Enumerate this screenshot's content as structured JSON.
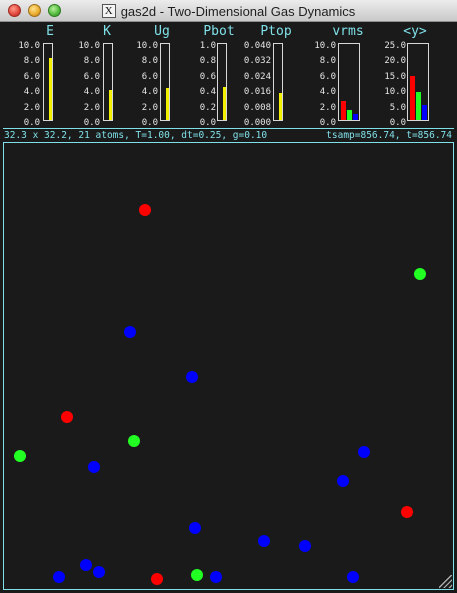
{
  "window": {
    "title": "gas2d - Two-Dimensional Gas Dynamics",
    "x_icon": "X"
  },
  "colors": {
    "label": "#7fe0e8",
    "bar_yellow": "#f0f000",
    "red": "#ff0000",
    "green": "#22ff22",
    "blue": "#0000ff",
    "background": "#1a1a1a"
  },
  "meters": [
    {
      "name": "E",
      "ticks": [
        "10.0",
        "8.0",
        "6.0",
        "4.0",
        "2.0",
        "0.0"
      ],
      "max": 10.0,
      "bars": [
        {
          "value": 8.1,
          "color": "#f0f000"
        }
      ]
    },
    {
      "name": "K",
      "ticks": [
        "10.0",
        "8.0",
        "6.0",
        "4.0",
        "2.0",
        "0.0"
      ],
      "max": 10.0,
      "bars": [
        {
          "value": 4.0,
          "color": "#f0f000"
        }
      ]
    },
    {
      "name": "Ug",
      "ticks": [
        "10.0",
        "8.0",
        "6.0",
        "4.0",
        "2.0",
        "0.0"
      ],
      "max": 10.0,
      "bars": [
        {
          "value": 4.2,
          "color": "#f0f000"
        }
      ]
    },
    {
      "name": "Pbot",
      "ticks": [
        "1.0",
        "0.8",
        "0.6",
        "0.4",
        "0.2",
        "0.0"
      ],
      "max": 1.0,
      "bars": [
        {
          "value": 0.43,
          "color": "#f0f000"
        }
      ]
    },
    {
      "name": "Ptop",
      "ticks": [
        "0.040",
        "0.032",
        "0.024",
        "0.016",
        "0.008",
        "0.000"
      ],
      "max": 0.04,
      "bars": [
        {
          "value": 0.014,
          "color": "#f0f000"
        }
      ]
    },
    {
      "name": "vrms",
      "ticks": [
        "10.0",
        "8.0",
        "6.0",
        "4.0",
        "2.0",
        "0.0"
      ],
      "max": 10.0,
      "bars": [
        {
          "value": 2.5,
          "color": "#ff0000"
        },
        {
          "value": 1.3,
          "color": "#22ff22"
        },
        {
          "value": 0.8,
          "color": "#0000ff"
        }
      ]
    },
    {
      "name": "<y>",
      "ticks": [
        "25.0",
        "20.0",
        "15.0",
        "10.0",
        "5.0",
        "0.0"
      ],
      "max": 25.0,
      "bars": [
        {
          "value": 14.5,
          "color": "#ff0000"
        },
        {
          "value": 9.3,
          "color": "#22ff22"
        },
        {
          "value": 4.8,
          "color": "#0000ff"
        }
      ]
    }
  ],
  "status": {
    "left": "32.3 x 32.2, 21 atoms, T=1.00, dt=0.25, g=0.10",
    "right": "tsamp=856.74, t=856.74"
  }
}
